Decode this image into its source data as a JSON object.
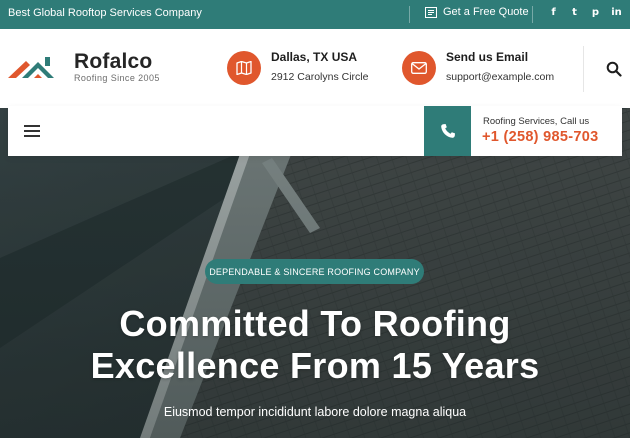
{
  "topbar": {
    "tagline": "Best Global Rooftop Services Company",
    "quote_label": "Get a Free Quote",
    "socials": [
      {
        "icon": "facebook-icon",
        "glyph": "f"
      },
      {
        "icon": "twitter-icon",
        "glyph": "t"
      },
      {
        "icon": "pinterest-icon",
        "glyph": "p"
      },
      {
        "icon": "linkedin-icon",
        "glyph": "in"
      }
    ]
  },
  "header": {
    "logo_name": "Rofalco",
    "logo_sub": "Roofing Since 2005",
    "location": {
      "title": "Dallas, TX USA",
      "sub": "2912 Carolyns Circle",
      "icon": "map-icon"
    },
    "email": {
      "title": "Send us Email",
      "sub": "support@example.com",
      "icon": "envelope-icon"
    }
  },
  "nav": {
    "call_label": "Roofing Services, Call us",
    "call_number": "+1 (258) 985-703"
  },
  "hero": {
    "badge": "DEPENDABLE & SINCERE ROOFING COMPANY",
    "headline_line1": "Committed To Roofing",
    "headline_line2": "Excellence From 15 Years",
    "subline": "Eiusmod tempor incididunt labore dolore magna aliqua"
  },
  "colors": {
    "primary": "#2f7c78",
    "accent": "#e0572d",
    "text_dark": "#1e1e1e"
  }
}
